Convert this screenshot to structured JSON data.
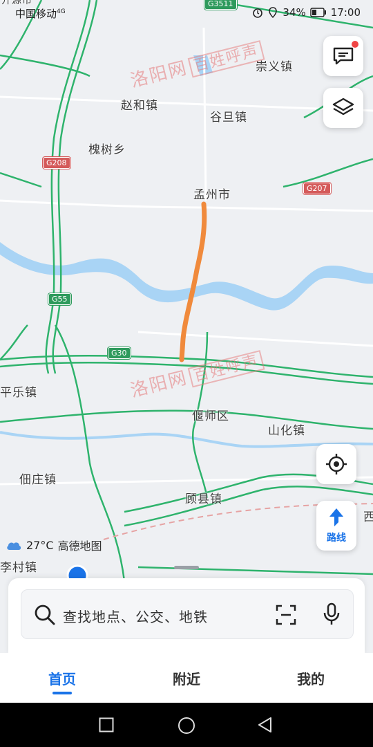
{
  "status_bar": {
    "carrier": "中国移动",
    "network": "4G",
    "battery": "34%",
    "time": "17:00"
  },
  "map": {
    "places": [
      "崇义镇",
      "赵和镇",
      "谷旦镇",
      "槐树乡",
      "孟州市",
      "平乐镇",
      "偃师区",
      "山化镇",
      "佃庄镇",
      "顾县镇",
      "李村镇",
      "西"
    ],
    "road_tags": [
      "G3511",
      "G208",
      "G207",
      "G55",
      "G30"
    ],
    "top_edge_label": "开源市",
    "colors": {
      "highway": "#2eb36c",
      "river": "#a9d4f5",
      "route": "#f08a3c",
      "road_tag": "#d45a5a"
    }
  },
  "watermark": {
    "logo_text": "洛阳网",
    "boxed_text": "百姓呼声"
  },
  "weather": {
    "temp": "27°C",
    "provider": "高德地图",
    "icon": "cloud-icon"
  },
  "buttons": {
    "messages_icon": "message-icon",
    "layers_icon": "layers-icon",
    "locate_icon": "locate-icon",
    "route_label": "路线"
  },
  "search": {
    "placeholder": "查找地点、公交、地铁"
  },
  "tabs": [
    {
      "label": "首页",
      "active": true
    },
    {
      "label": "附近",
      "active": false
    },
    {
      "label": "我的",
      "active": false
    }
  ]
}
